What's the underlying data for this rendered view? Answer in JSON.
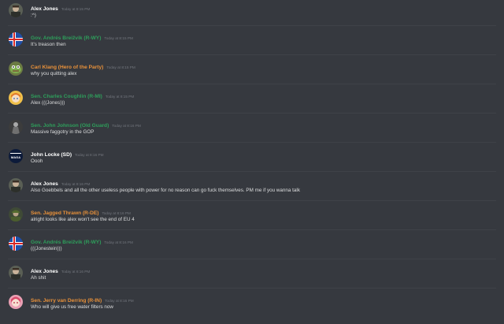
{
  "colors": {
    "background": "#36393f",
    "name_default": "#ffffff",
    "name_green": "#2e9e5b",
    "name_orange": "#e8913a",
    "timestamp": "#72767d",
    "message_text": "#dcddde"
  },
  "messages": [
    {
      "author": "Alex Jones",
      "timestamp": "Today at 8:15 PM",
      "text": ":^)",
      "name_color": "#ffffff",
      "avatar": "alex-jones-avatar-icon"
    },
    {
      "author": "Gov. Andrés Breižvik (R-WY)",
      "timestamp": "Today at 8:15 PM",
      "text": "It's treason then",
      "name_color": "#2e9e5b",
      "avatar": "iceland-flag-avatar-icon"
    },
    {
      "author": "Carl Klang (Hero of the Party)",
      "timestamp": "Today at 8:15 PM",
      "text": "why you quitting alex",
      "name_color": "#e8913a",
      "avatar": "frog-avatar-icon"
    },
    {
      "author": "Sen. Charles Coughlin (R-MI)",
      "timestamp": "Today at 8:15 PM",
      "text": "Alex (((Jones)))",
      "name_color": "#2e9e5b",
      "avatar": "anime-girl-avatar-icon"
    },
    {
      "author": "Sen. John Johnson (Old Guard)",
      "timestamp": "Today at 8:16 PM",
      "text": "Massive faggotry in the GOP",
      "name_color": "#2e9e5b",
      "avatar": "old-photo-avatar-icon"
    },
    {
      "author": "John Locke (SD)",
      "timestamp": "Today at 8:16 PM",
      "text": "Oooh",
      "name_color": "#ffffff",
      "avatar": "trumpkin-logo-avatar-icon",
      "avatar_text": "MAGA"
    },
    {
      "author": "Alex Jones",
      "timestamp": "Today at 8:16 PM",
      "text": "Also Goebbels and all the other useless people with power for no reason can go fuck themselves. PM me if you wanna talk",
      "name_color": "#ffffff",
      "avatar": "alex-jones-avatar-icon"
    },
    {
      "author": "Sen. Jagged Thrawn (R-DE)",
      "timestamp": "Today at 8:16 PM",
      "text": "alright looks like alex won't see the end of EU 4",
      "name_color": "#e8913a",
      "avatar": "soldier-avatar-icon"
    },
    {
      "author": "Gov. Andrés Breižvik (R-WY)",
      "timestamp": "Today at 8:16 PM",
      "text": "(((Jonestein)))",
      "name_color": "#2e9e5b",
      "avatar": "iceland-flag-avatar-icon"
    },
    {
      "author": "Alex Jones",
      "timestamp": "Today at 8:16 PM",
      "text": "Ah shit",
      "name_color": "#ffffff",
      "avatar": "alex-jones-avatar-icon"
    },
    {
      "author": "Sen. Jerry van Derring (R-IN)",
      "timestamp": "Today at 8:16 PM",
      "text": "Who will give us free water filters now",
      "name_color": "#e8913a",
      "avatar": "pink-hair-avatar-icon"
    }
  ]
}
